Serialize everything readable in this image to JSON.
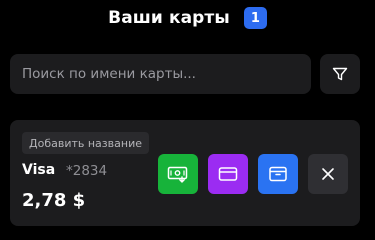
{
  "header": {
    "title": "Ваши карты",
    "count": "1"
  },
  "search": {
    "placeholder": "Поиск по имени карты...",
    "value": ""
  },
  "filter": {
    "icon": "filter-icon"
  },
  "cards": [
    {
      "add_name_label": "Добавить название",
      "brand": "Visa",
      "number": "*2834",
      "balance": "2,78 $",
      "actions": [
        {
          "icon": "top-up-icon",
          "color": "#17b33a"
        },
        {
          "icon": "credit-card-icon",
          "color": "#9b2cf2"
        },
        {
          "icon": "wallet-icon",
          "color": "#2a73f2"
        },
        {
          "icon": "close-icon",
          "color": "#2f2f33"
        }
      ]
    }
  ],
  "colors": {
    "background": "#000000",
    "surface": "#1c1c1e",
    "accent": "#2d6cf0",
    "muted_text": "#8e8e93"
  }
}
